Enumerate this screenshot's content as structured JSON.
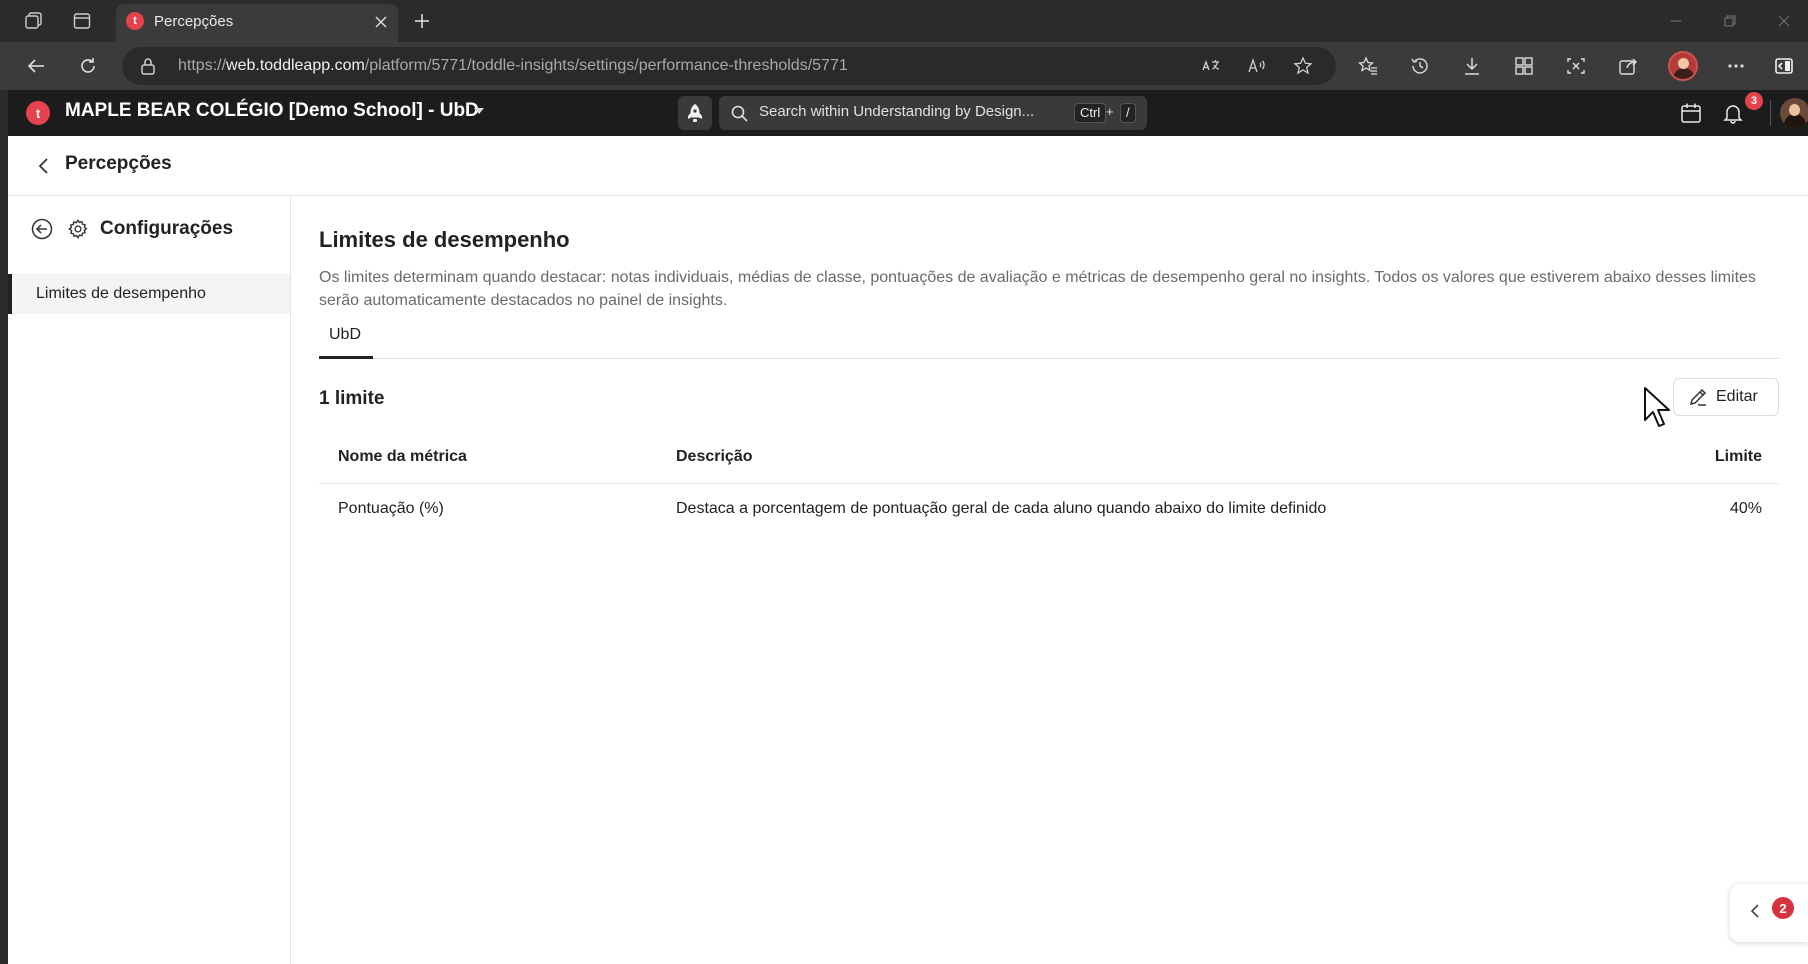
{
  "browser": {
    "tab_title": "Percepções",
    "tab_favicon_letter": "t",
    "url_host": "web.toddleapp.com",
    "url_prefix": "https://",
    "url_path": "/platform/5771/toddle-insights/settings/performance-thresholds/5771"
  },
  "app_header": {
    "logo_letter": "t",
    "school_name": "MAPLE BEAR COLÉGIO [Demo School] - UbD",
    "search_placeholder": "Search within Understanding by Design...",
    "shortcut_key1": "Ctrl",
    "shortcut_plus": "+",
    "shortcut_key2": "/",
    "notification_count": "3"
  },
  "page": {
    "topbar_title": "Percepções",
    "sidebar": {
      "title": "Configurações",
      "items": [
        {
          "label": "Limites de desempenho",
          "active": true
        }
      ]
    },
    "content": {
      "title": "Limites de desempenho",
      "description": "Os limites determinam quando destacar: notas individuais, médias de classe, pontuações de avaliação e métricas de desempenho geral no insights. Todos os valores que estiverem abaixo desses limites serão automaticamente destacados no painel de insights.",
      "tabs": [
        {
          "label": "UbD",
          "active": true
        }
      ],
      "count_label": "1 limite",
      "edit_label": "Editar",
      "table": {
        "headers": [
          "Nome da métrica",
          "Descrição",
          "Limite"
        ],
        "rows": [
          [
            "Pontuação (%)",
            "Destaca a porcentagem de pontuação geral de cada aluno quando abaixo do limite definido",
            "40%"
          ]
        ]
      }
    },
    "fab_badge": "2"
  },
  "colors": {
    "brand": "#e5424d",
    "badge": "#d9323f",
    "chrome_dark": "#2b2b2b",
    "app_header": "#1c1c1c"
  }
}
